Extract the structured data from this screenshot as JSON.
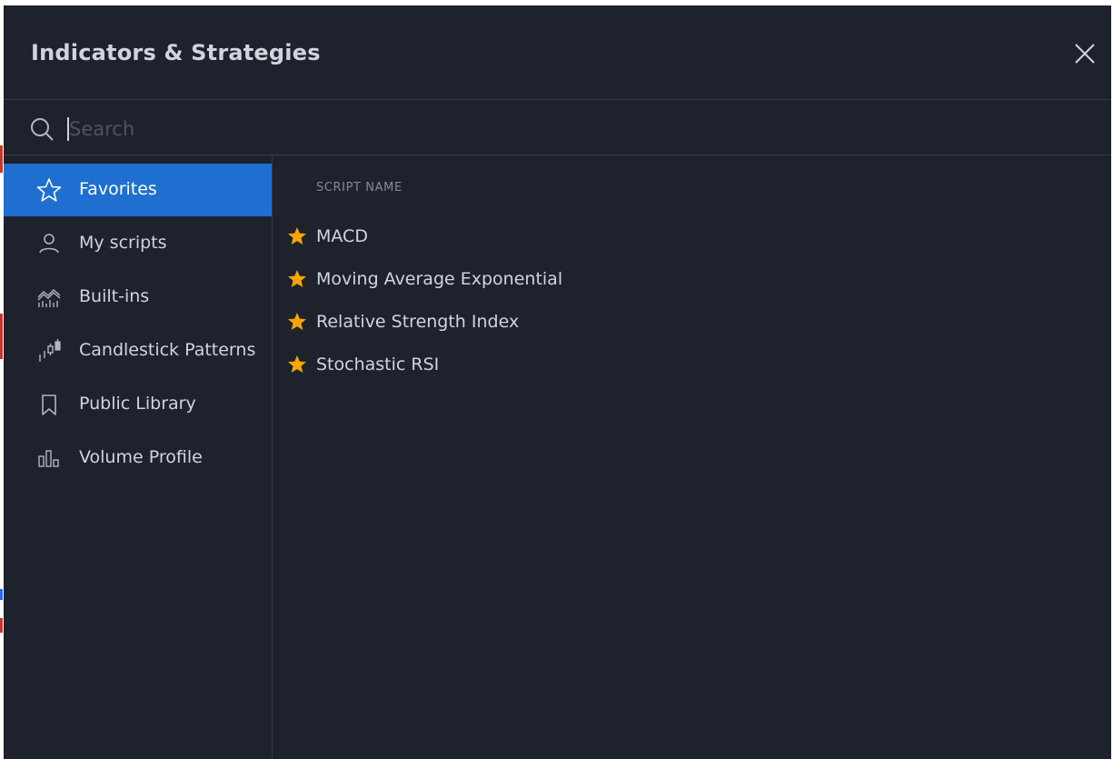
{
  "dialog": {
    "title": "Indicators & Strategies",
    "close_icon": "close-icon"
  },
  "search": {
    "placeholder": "Search",
    "value": "",
    "icon": "search-icon"
  },
  "sidebar": {
    "items": [
      {
        "label": "Favorites",
        "icon": "star-outline-icon",
        "active": true
      },
      {
        "label": "My scripts",
        "icon": "user-icon",
        "active": false
      },
      {
        "label": "Built-ins",
        "icon": "builtins-chart-icon",
        "active": false
      },
      {
        "label": "Candlestick Patterns",
        "icon": "candlestick-icon",
        "active": false
      },
      {
        "label": "Public Library",
        "icon": "bookmark-icon",
        "active": false
      },
      {
        "label": "Volume Profile",
        "icon": "volume-profile-icon",
        "active": false
      }
    ]
  },
  "content": {
    "column_header": "SCRIPT NAME",
    "scripts": [
      {
        "name": "MACD",
        "favorite": true
      },
      {
        "name": "Moving Average Exponential",
        "favorite": true
      },
      {
        "name": "Relative Strength Index",
        "favorite": true
      },
      {
        "name": "Stochastic RSI",
        "favorite": true
      }
    ]
  },
  "colors": {
    "background": "#1e222d",
    "text": "#d1d4dc",
    "muted_text": "#868993",
    "active_item": "#1e6fd0",
    "star": "#f7a600",
    "divider": "#363a45"
  }
}
